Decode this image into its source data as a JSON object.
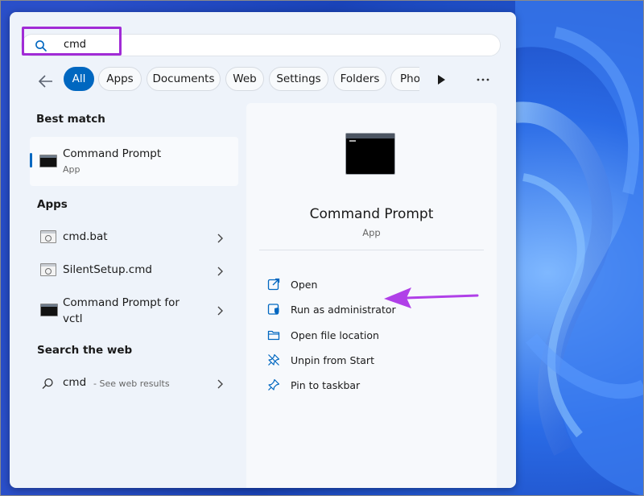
{
  "search": {
    "query": "cmd"
  },
  "filters": {
    "items": [
      {
        "label": "All",
        "active": true
      },
      {
        "label": "Apps",
        "active": false
      },
      {
        "label": "Documents",
        "active": false
      },
      {
        "label": "Web",
        "active": false
      },
      {
        "label": "Settings",
        "active": false
      },
      {
        "label": "Folders",
        "active": false
      },
      {
        "label": "Photos",
        "active": false
      }
    ]
  },
  "best_match": {
    "section_label": "Best match",
    "title": "Command Prompt",
    "subtitle": "App"
  },
  "apps": {
    "section_label": "Apps",
    "items": [
      {
        "name": "cmd.bat"
      },
      {
        "name": "SilentSetup.cmd"
      },
      {
        "name_line1": "Command Prompt for",
        "name_line2": "vctl"
      }
    ]
  },
  "web": {
    "section_label": "Search the web",
    "query": "cmd",
    "suffix": "- See web results"
  },
  "preview": {
    "title": "Command Prompt",
    "subtitle": "App",
    "actions": [
      {
        "label": "Open",
        "icon": "open-icon"
      },
      {
        "label": "Run as administrator",
        "icon": "shield-icon"
      },
      {
        "label": "Open file location",
        "icon": "folder-icon"
      },
      {
        "label": "Unpin from Start",
        "icon": "unpin-icon"
      },
      {
        "label": "Pin to taskbar",
        "icon": "pin-icon"
      }
    ]
  },
  "colors": {
    "accent": "#0067c0",
    "highlight": "#a12bd6",
    "arrow": "#b040e8"
  }
}
